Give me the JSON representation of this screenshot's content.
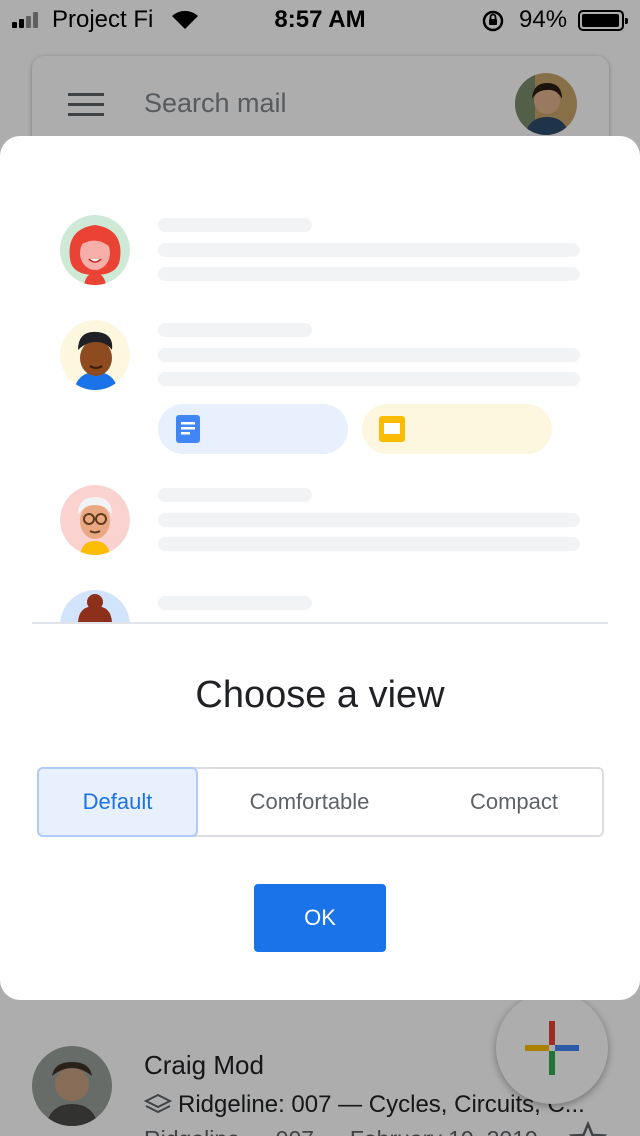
{
  "status_bar": {
    "carrier": "Project Fi",
    "time": "8:57 AM",
    "battery": "94%",
    "battery_level": 0.94
  },
  "search": {
    "placeholder": "Search mail"
  },
  "inbox": {
    "item": {
      "sender": "Craig Mod",
      "subject": "Ridgeline: 007 — Cycles, Circuits, C...",
      "snippet": "Ridgeline — 007 — February 19, 2019"
    }
  },
  "dialog": {
    "title": "Choose a view",
    "options": [
      "Default",
      "Comfortable",
      "Compact"
    ],
    "selected": "Default",
    "ok_label": "OK"
  },
  "colors": {
    "accent": "#1a73e8",
    "selected_bg": "#e8f0fe",
    "docs_chip": "#e8f0fe",
    "docs_icon": "#4285f4",
    "slides_chip": "#fef7e0",
    "slides_icon": "#fbbc04"
  }
}
